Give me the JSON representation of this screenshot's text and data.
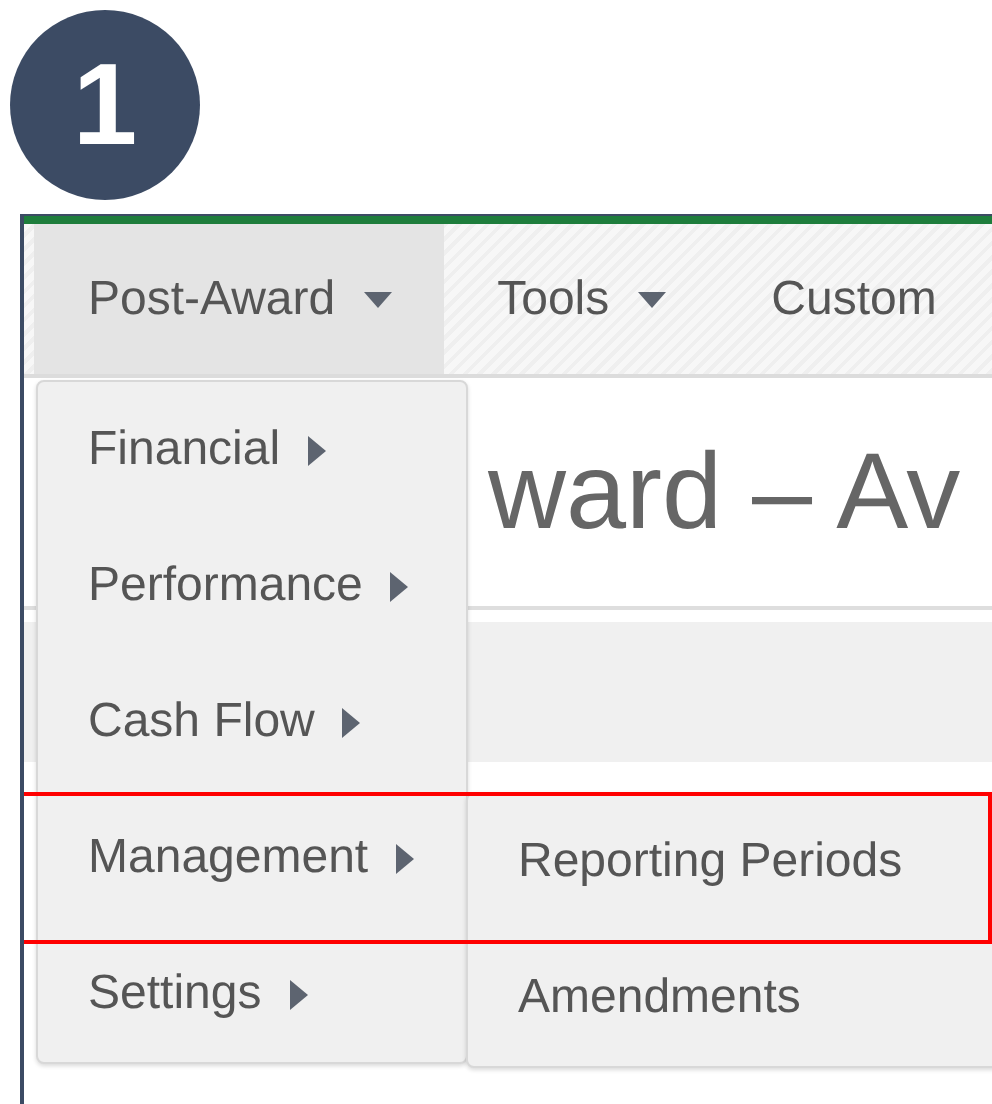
{
  "badge": {
    "label": "1"
  },
  "navbar": {
    "items": [
      {
        "label": "Post-Award",
        "selected": true,
        "caret": true
      },
      {
        "label": "Tools",
        "selected": false,
        "caret": true
      },
      {
        "label": "Custom",
        "selected": false,
        "caret": false
      }
    ]
  },
  "page": {
    "heading": "ward – Av"
  },
  "menu": {
    "items": [
      {
        "label": "Financial",
        "annotated": false
      },
      {
        "label": "Performance",
        "annotated": false
      },
      {
        "label": "Cash Flow",
        "annotated": false
      },
      {
        "label": "Management",
        "annotated": true
      },
      {
        "label": "Settings",
        "annotated": false
      }
    ]
  },
  "submenu": {
    "items": [
      {
        "label": "Reporting Periods"
      },
      {
        "label": "Amendments"
      }
    ]
  }
}
